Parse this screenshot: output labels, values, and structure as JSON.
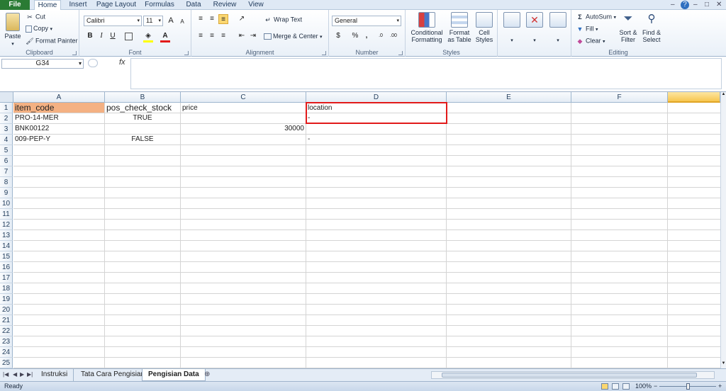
{
  "ribbon_tabs": {
    "file": "File",
    "home": "Home",
    "insert": "Insert",
    "page_layout": "Page Layout",
    "formulas": "Formulas",
    "data": "Data",
    "review": "Review",
    "view": "View"
  },
  "window_controls": {
    "minimize": "–",
    "help": "?",
    "restore": "□",
    "close": "✕"
  },
  "clipboard": {
    "paste": "Paste",
    "cut": "Cut",
    "copy": "Copy",
    "format_painter": "Format Painter",
    "label": "Clipboard"
  },
  "font": {
    "name": "Calibri",
    "size": "11",
    "bold": "B",
    "italic": "I",
    "underline": "U",
    "grow": "A",
    "shrink": "A",
    "label": "Font"
  },
  "alignment": {
    "wrap_text": "Wrap Text",
    "merge_center": "Merge & Center",
    "label": "Alignment"
  },
  "number": {
    "format": "General",
    "percent": "%",
    "comma": ",",
    "label": "Number"
  },
  "styles": {
    "conditional": "Conditional Formatting",
    "format_table": "Format as Table",
    "cell_styles": "Cell Styles",
    "label": "Styles"
  },
  "cells": {
    "A1": "item_code",
    "B1": "pos_check_stock",
    "C1": "price",
    "D1": "location",
    "A2": "PRO-14-MER",
    "B2": "TRUE",
    "D2": "-",
    "A3": "BNK00122",
    "C3": "30000",
    "A4": "009-PEP-Y",
    "B4": "FALSE",
    "D4": "-"
  },
  "editing": {
    "autosum": "AutoSum",
    "fill": "Fill",
    "clear": "Clear",
    "sort_filter": "Sort & Filter",
    "find_select": "Find & Select",
    "label": "Editing"
  },
  "formula_bar": {
    "name_box": "G34",
    "fx": "fx",
    "value": ""
  },
  "columns": [
    "A",
    "B",
    "C",
    "D",
    "E",
    "F"
  ],
  "rows": [
    "1",
    "2",
    "3",
    "4",
    "5",
    "6",
    "7",
    "8",
    "9",
    "10",
    "11",
    "12",
    "13",
    "14",
    "15",
    "16",
    "17",
    "18",
    "19",
    "20",
    "21",
    "22",
    "23",
    "24",
    "25"
  ],
  "sheets": [
    "Instruksi",
    "Tata Cara Pengisian",
    "Pengisian Data"
  ],
  "active_sheet": "Pengisian Data",
  "status": {
    "text": "Ready",
    "zoom": "100%"
  },
  "colors": {
    "header_fill": "#f4b183",
    "highlight_border": "#e21a1a",
    "file_tab": "#2a7b34"
  }
}
